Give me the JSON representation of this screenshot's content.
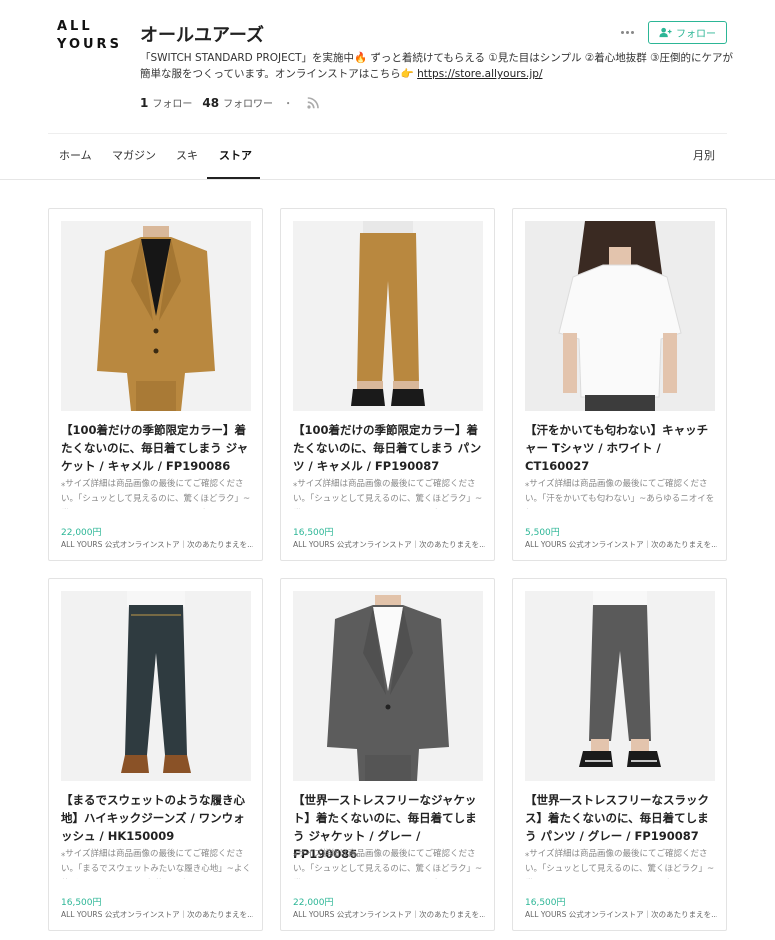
{
  "profile": {
    "logo_line1": "ALL",
    "logo_line2": "YOURS",
    "name": "オールユアーズ",
    "bio_text": "「SWITCH STANDARD PROJECT」を実施中🔥 ずっと着続けてもらえる ①見た目はシンプル ②着心地抜群 ③圧倒的にケアが簡単な服をつくっています。オンラインストアはこちら👉 ",
    "bio_link": "https://store.allyours.jp/",
    "follow_count": "1",
    "follow_label": "フォロー",
    "follower_count": "48",
    "follower_label": "フォロワー",
    "stats_separator": "・",
    "follow_button_label": "フォロー"
  },
  "tabs": [
    {
      "label": "ホーム"
    },
    {
      "label": "マガジン"
    },
    {
      "label": "スキ"
    },
    {
      "label": "ストア",
      "active": true
    }
  ],
  "monthly_label": "月別",
  "colors": {
    "accent": "#2cb696",
    "camel": "#b9883f",
    "gray": "#5c5c5c",
    "denim": "#2f3b40"
  },
  "products": [
    {
      "title": "【100着だけの季節限定カラー】着たくないのに、毎日着てしまう ジャケット / キャメル / FP190086",
      "desc": "⁎サイズ詳細は商品画像の最後にてご確認ください。「シュッとして見えるのに、驚くほどラク」~世界一ストレスフリーなジャケットがで...",
      "price": "22,000円",
      "shop": "ALL YOURS 公式オンラインストア｜次のあたりまえを..."
    },
    {
      "title": "【100着だけの季節限定カラー】着たくないのに、毎日着てしまう パンツ / キャメル / FP190087",
      "desc": "⁎サイズ詳細は商品画像の最後にてご確認ください。「シュッとして見えるのに、驚くほどラク」~世界一ストレスフリーなスラックスがで...",
      "price": "16,500円",
      "shop": "ALL YOURS 公式オンラインストア｜次のあたりまえを..."
    },
    {
      "title": "【汗をかいても匂わない】キャッチャー Tシャツ / ホワイト / CT160027",
      "desc": "⁎サイズ詳細は商品画像の最後にてご確認ください。「汗をかいても匂わない」~あらゆるニオイを無くすコットンTシャツ~ このTシャツは...",
      "price": "5,500円",
      "shop": "ALL YOURS 公式オンラインストア｜次のあたりまえを..."
    },
    {
      "title": "【まるでスウェットのような履き心地】ハイキックジーンズ / ワンウォッシュ / HK150009",
      "desc": "⁎サイズ詳細は商品画像の最後にてご確認ください。「まるでスウェットみたいな履き心地」~よく伸びるのに柔らかく、色落ちも楽しめるセ...",
      "price": "16,500円",
      "shop": "ALL YOURS 公式オンラインストア｜次のあたりまえを..."
    },
    {
      "title": "【世界一ストレスフリーなジャケット】着たくないのに、毎日着てしまう ジャケット / グレー / FP190086",
      "desc": "⁎サイズ詳細は商品画像の最後にてご確認ください。「シュッとして見えるのに、驚くほどラク」~世界一ストレスフリーなジャケットがで...",
      "price": "22,000円",
      "shop": "ALL YOURS 公式オンラインストア｜次のあたりまえを..."
    },
    {
      "title": "【世界一ストレスフリーなスラックス】着たくないのに、毎日着てしまう パンツ / グレー / FP190087",
      "desc": "⁎サイズ詳細は商品画像の最後にてご確認ください。「シュッとして見えるのに、驚くほどラク」~世界一ストレスフリーなスラックスがで...",
      "price": "16,500円",
      "shop": "ALL YOURS 公式オンラインストア｜次のあたりまえを..."
    }
  ]
}
